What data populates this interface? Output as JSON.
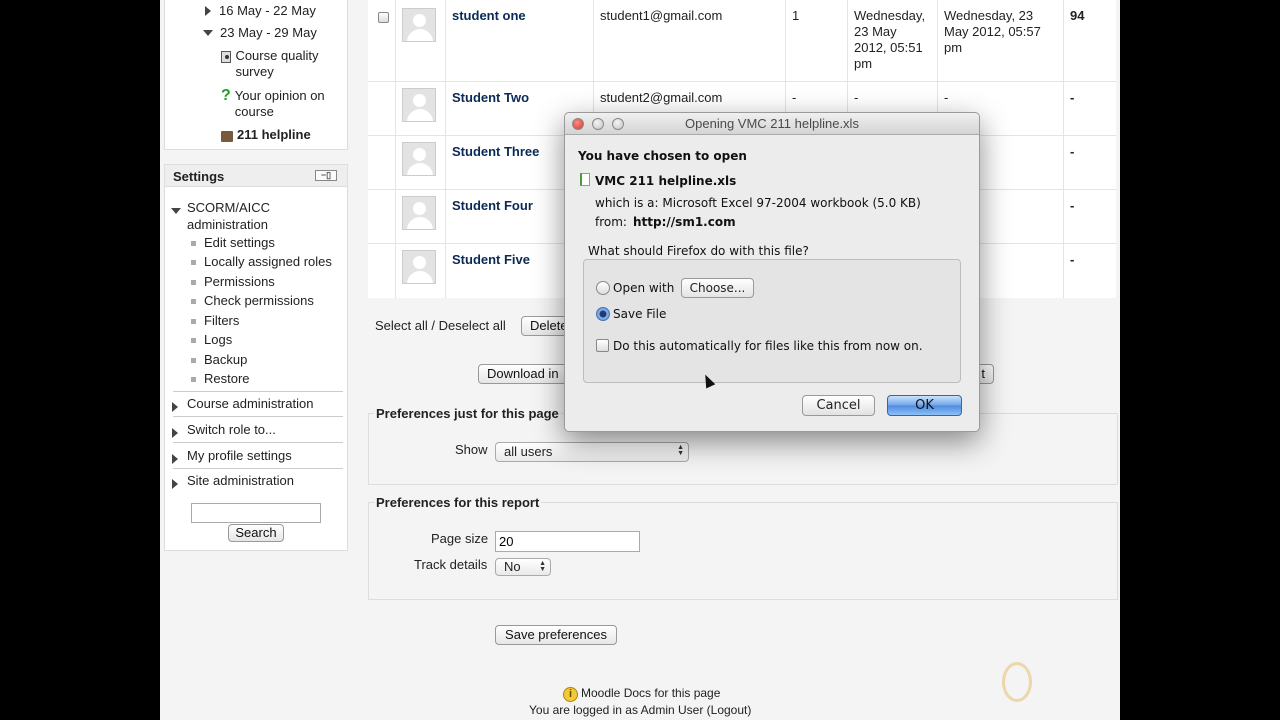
{
  "nav": {
    "items": [
      {
        "label": "16 May - 22 May"
      },
      {
        "label": "23 May - 29 May"
      },
      {
        "label": "Course quality survey"
      },
      {
        "label": "Your opinion on course"
      },
      {
        "label": "211 helpline"
      }
    ]
  },
  "settings": {
    "title": "Settings",
    "scorm_label": "SCORM/AICC administration",
    "sub_items": [
      "Edit settings",
      "Locally assigned roles",
      "Permissions",
      "Check permissions",
      "Filters",
      "Logs",
      "Backup",
      "Restore"
    ],
    "sections": [
      "Course administration",
      "Switch role to...",
      "My profile settings",
      "Site administration"
    ],
    "search_label": "Search",
    "search_value": ""
  },
  "table": {
    "rows": [
      {
        "name": "student one",
        "email": "student1@gmail.com",
        "attempts": "1",
        "started": "Wednesday, 23 May 2012, 05:51 pm",
        "last": "Wednesday, 23 May 2012, 05:57 pm",
        "grade": "94"
      },
      {
        "name": "Student Two",
        "email": "student2@gmail.com",
        "attempts": "-",
        "started": "-",
        "last": "-",
        "grade": "-"
      },
      {
        "name": "Student Three",
        "email": "",
        "attempts": "",
        "started": "",
        "last": "",
        "grade": "-"
      },
      {
        "name": "Student Four",
        "email": "",
        "attempts": "",
        "started": "",
        "last": "",
        "grade": "-"
      },
      {
        "name": "Student Five",
        "email": "",
        "attempts": "",
        "started": "",
        "last": "",
        "grade": "-"
      }
    ]
  },
  "actions": {
    "select_all": "Select all / Deselect all",
    "delete_label": "Delete",
    "download_label": "Download in",
    "export_tail": "t"
  },
  "prefs_page": {
    "legend": "Preferences just for this page",
    "show_label": "Show",
    "show_value": "all users"
  },
  "prefs_report": {
    "legend": "Preferences for this report",
    "pagesize_label": "Page size",
    "pagesize_value": "20",
    "track_label": "Track details",
    "track_value": "No",
    "save_label": "Save preferences"
  },
  "footer": {
    "docs_link": "Moodle Docs for this page",
    "logged_in": "You are logged in as Admin User (Logout)"
  },
  "dialog": {
    "title": "Opening VMC 211 helpline.xls",
    "chosen": "You have chosen to open",
    "filename": "VMC 211 helpline.xls",
    "which_is": "which is a:  Microsoft Excel 97-2004 workbook (5.0 KB)",
    "from_label": "from:",
    "from_url": "http://sm1.com",
    "question": "What should Firefox do with this file?",
    "open_with": "Open with",
    "choose": "Choose...",
    "save_file": "Save File",
    "auto": "Do this automatically for files like this from now on.",
    "cancel": "Cancel",
    "ok": "OK",
    "selected_option": "save_file",
    "accent": "#3a7ae0"
  }
}
